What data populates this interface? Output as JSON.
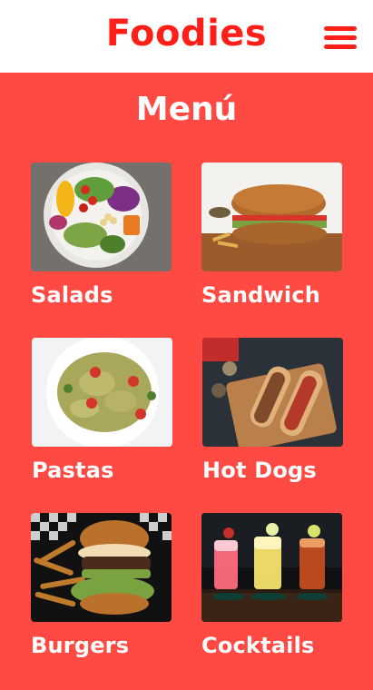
{
  "header": {
    "brand": "Foodies",
    "menu_icon": "hamburger-menu-icon"
  },
  "page": {
    "title": "Menú"
  },
  "categories": [
    {
      "label": "Salads",
      "image": "salad-bowl-image"
    },
    {
      "label": "Sandwich",
      "image": "sandwich-image"
    },
    {
      "label": "Pastas",
      "image": "pasta-image"
    },
    {
      "label": "Hot Dogs",
      "image": "hot-dogs-image"
    },
    {
      "label": "Burgers",
      "image": "burger-fries-image"
    },
    {
      "label": "Cocktails",
      "image": "cocktails-image"
    }
  ],
  "colors": {
    "brand_red": "#ff1e18",
    "page_background": "#ff4a44",
    "header_background": "#ffffff",
    "label_text": "#ffffff"
  }
}
